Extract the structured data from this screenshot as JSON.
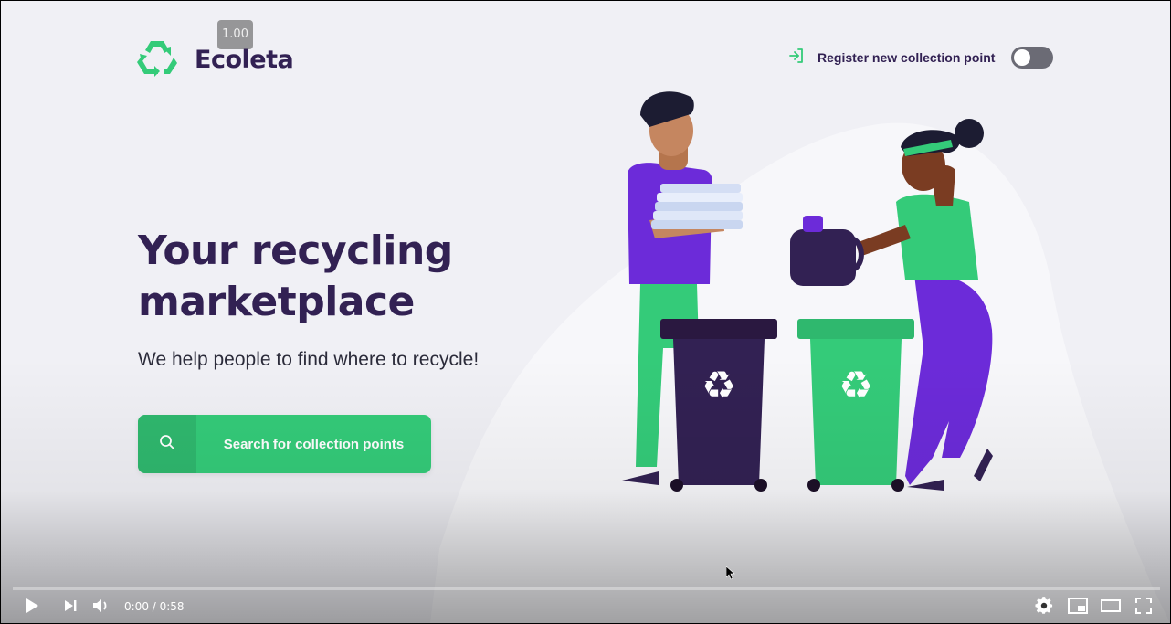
{
  "player": {
    "speed_badge": "1.00",
    "time_display": "0:00 / 0:58",
    "progress": 0.0
  },
  "page": {
    "logo_text": "Ecoleta",
    "register_label": "Register new collection point",
    "headline_line1": "Your recycling",
    "headline_line2": "marketplace",
    "subline": "We help people to find where to recycle!",
    "search_button_label": "Search for collection points"
  },
  "colors": {
    "brand_green": "#34cb79",
    "brand_dark": "#322153",
    "accent_purple": "#6c2bd9",
    "background": "#f0f0f5"
  },
  "icons": {
    "logo": "recycle-icon",
    "register": "sign-in-icon",
    "search": "search-icon",
    "play": "play-icon",
    "next": "next-icon",
    "volume": "volume-icon",
    "settings": "gear-icon",
    "miniplayer": "miniplayer-icon",
    "theater": "theater-icon",
    "fullscreen": "fullscreen-icon"
  }
}
